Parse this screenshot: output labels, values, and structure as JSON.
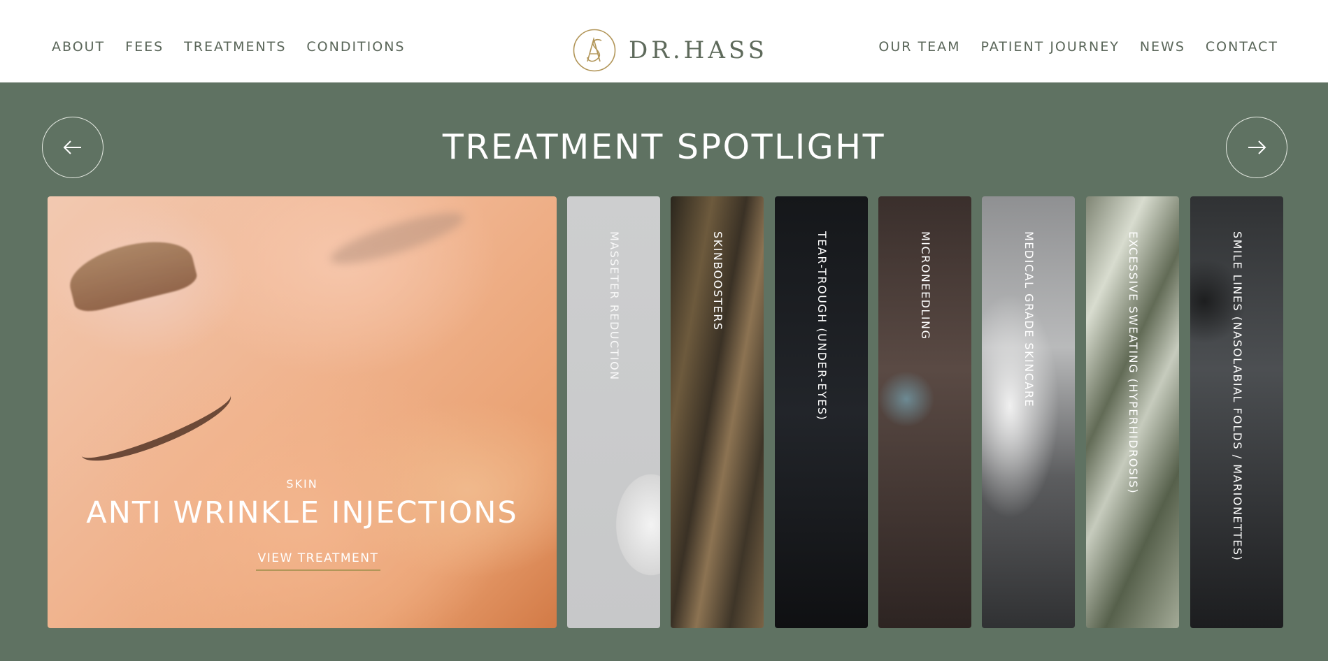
{
  "header": {
    "nav_left": [
      "ABOUT",
      "FEES",
      "TREATMENTS",
      "CONDITIONS"
    ],
    "nav_right": [
      "OUR TEAM",
      "PATIENT JOURNEY",
      "NEWS",
      "CONTACT"
    ],
    "logo_text": "DR.HASS",
    "logo_mark_icon": "hass-monogram-icon"
  },
  "hero": {
    "title": "TREATMENT SPOTLIGHT",
    "prev_icon": "arrow-left-icon",
    "next_icon": "arrow-right-icon",
    "featured": {
      "category": "SKIN",
      "title": "ANTI WRINKLE INJECTIONS",
      "link": "VIEW TREATMENT"
    },
    "strips": [
      "MASSETER REDUCTION",
      "SKINBOOSTERS",
      "TEAR-TROUGH (UNDER-EYES)",
      "MICRONEEDLING",
      "MEDICAL GRADE SKINCARE",
      "EXCESSIVE SWEATING (HYPERHIDROSIS)",
      "SMILE LINES (NASOLABIAL FOLDS / MARIONETTES)"
    ]
  },
  "colors": {
    "hero_bg": "#5f7262",
    "nav_text": "#5a6659",
    "logo_gold": "#b29659",
    "underline_gold": "#b29659"
  }
}
